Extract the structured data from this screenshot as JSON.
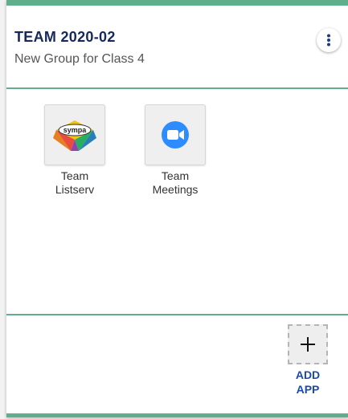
{
  "team": {
    "title": "TEAM 2020-02",
    "subtitle": "New Group for Class 4",
    "menu_icon": "more-vertical-icon"
  },
  "apps": [
    {
      "label": "Team\nListserv",
      "icon": "sympa-logo-icon",
      "logo_text": "sympa"
    },
    {
      "label": "Team\nMeetings",
      "icon": "zoom-video-icon"
    }
  ],
  "add_app": {
    "label": "ADD\nAPP",
    "icon": "plus-icon"
  },
  "colors": {
    "accent": "#5fae8c",
    "title": "#15285a",
    "link": "#1a4ab0",
    "zoom": "#2d8cff"
  }
}
